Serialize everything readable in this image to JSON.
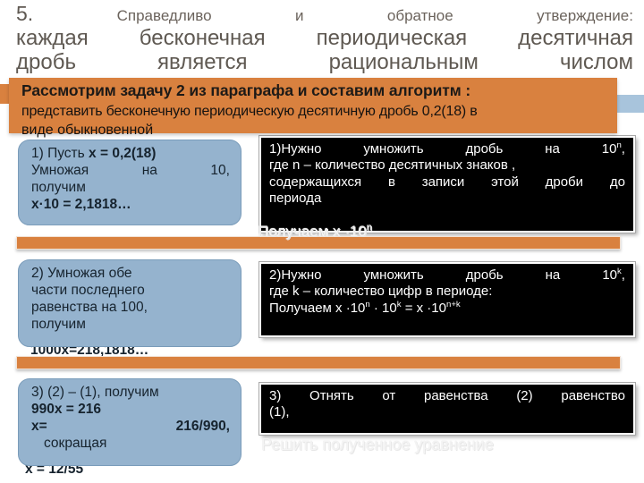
{
  "slide": {
    "heading": {
      "number": "5.",
      "line1_words": [
        "Справедливо",
        "и",
        "обратное",
        "утверждение:"
      ],
      "line2_words": [
        "каждая",
        "бесконечная",
        "периодическая",
        "десятичная"
      ],
      "line3_words": [
        "дробь",
        "является",
        "рациональным",
        "числом"
      ]
    },
    "banner": {
      "line1": "Рассмотрим задачу 2  из параграфа и составим алгоритм :",
      "line2": "представить бесконечную периодическую десятичную дробь 0,2(18) в",
      "line3": "виде обыкновенной"
    },
    "steps": [
      {
        "id": "step-1",
        "blue": {
          "line1_left": "1) Пусть",
          "line1_bold": "x = 0,2(18)",
          "row_words": [
            "Умножая",
            "на",
            "10,"
          ],
          "line3": "получим",
          "line4": "x·10 = 2,1818…"
        },
        "black": {
          "row_words": [
            "1)Нужно",
            "умножить",
            "дробь",
            "на",
            "10"
          ],
          "row_sup": "n",
          "row_tail": ",",
          "line2": "где n – количество десятичных знаков ,",
          "line3_words": [
            "содержащихся",
            "в",
            "записи",
            "этой",
            "дроби",
            "до"
          ],
          "line4": "периода"
        },
        "ghost": "Получаем  x ·10"
      },
      {
        "id": "step-2",
        "blue": {
          "line1": "2) Умножая обе",
          "line2": "части последнего",
          "line3": "равенства на 100,",
          "line4": "получим",
          "line5": "1000x=218,1818…"
        },
        "black": {
          "row_words": [
            "2)Нужно",
            "умножить",
            "дробь",
            "на",
            "10"
          ],
          "row_sup": "k",
          "row_tail": ",",
          "line2": "где k – количество цифр в периоде:",
          "line3_pre": "Получаем  x ·10",
          "line3_sup1": "n",
          "line3_mid": " · 10",
          "line3_sup2": "k",
          "line3_mid2": "  = x ·10",
          "line3_sup3": "n+k"
        }
      },
      {
        "id": "step-3",
        "blue": {
          "line1": "3)   (2) – (1), получим",
          "line2": "990x = 216",
          "line3_left": "x=",
          "line3_right": "216/990,",
          "line4": "сокращая",
          "line5": "x =  12/55"
        },
        "black": {
          "line1_words": [
            "3)",
            "Отнять",
            "от",
            "равенства",
            "(2)",
            "равенство"
          ],
          "line2": "(1),"
        },
        "ghost": "Решить полученное уравнение"
      }
    ],
    "colors": {
      "orange": "#d9813f",
      "blue_fill": "#95b3ce",
      "blue_border": "#7a9cba",
      "black_fill": "#000000",
      "heading_text": "#6b635c",
      "tab_blue": "#a8c4dc"
    }
  }
}
